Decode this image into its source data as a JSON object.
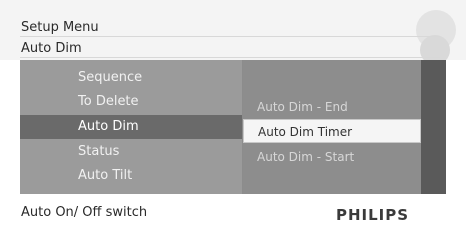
{
  "header": {
    "breadcrumb_parent": "Setup Menu",
    "breadcrumb_current": "Auto Dim"
  },
  "menu": {
    "items": [
      {
        "label": "Sequence"
      },
      {
        "label": "To Delete"
      },
      {
        "label": "Auto Dim"
      },
      {
        "label": "Status"
      },
      {
        "label": "Auto Tilt"
      }
    ]
  },
  "submenu": {
    "items": [
      {
        "label": "Auto Dim - End"
      },
      {
        "label": "Auto Dim Timer"
      },
      {
        "label": "Auto Dim - Start"
      }
    ]
  },
  "footer": {
    "help_text": "Auto On/ Off switch",
    "brand": "PHILIPS"
  },
  "colors": {
    "menu_bg": "#9b9b9b",
    "submenu_bg": "#8d8d8d",
    "selection_bg": "#6a6a6a",
    "submenu_selection_bg": "#f5f5f5",
    "brand_text": "#3a3a3a"
  }
}
